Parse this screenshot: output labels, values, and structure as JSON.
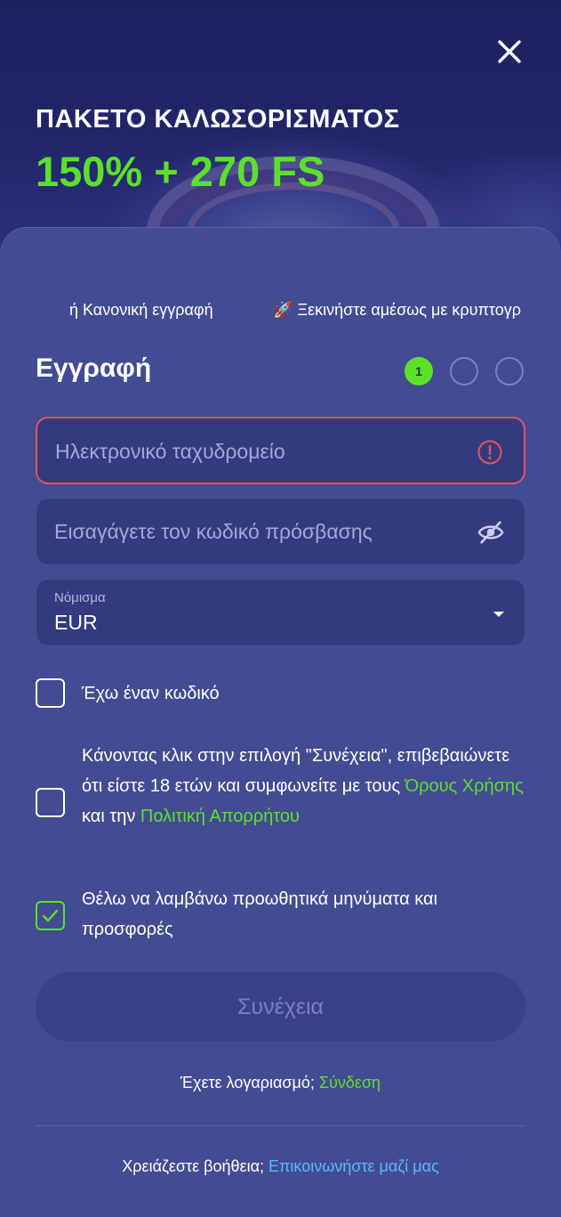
{
  "hero": {
    "title": "ΠΑΚΕΤΟ ΚΑΛΩΣΟΡΙΣΜΑΤΟΣ",
    "offer": "150% + 270 FS"
  },
  "tabs": [
    {
      "label": "ή Κανονική εγγραφή"
    },
    {
      "label": "🚀 Ξεκινήστε αμέσως με κρυπτογρ"
    }
  ],
  "form": {
    "title": "Εγγραφή",
    "steps": [
      "1",
      "",
      ""
    ],
    "email_placeholder": "Ηλεκτρονικό ταχυδρομείο",
    "password_placeholder": "Εισαγάγετε τον κωδικό πρόσβασης",
    "currency_label": "Νόμισμα",
    "currency_value": "EUR",
    "code_label": "Έχω έναν κωδικό",
    "terms_text_1": "Κάνοντας κλικ στην επιλογή \"Συνέχεια\", επιβεβαιώνετε ότι είστε 18 ετών και συμφωνείτε με τους ",
    "terms_link": "Όρους Χρήσης",
    "terms_text_2": " και την ",
    "privacy_link": "Πολιτική Απορρήτου",
    "promo_label": "Θέλω να λαμβάνω προωθητικά μηνύματα και προσφορές",
    "promo_checked": true,
    "continue_label": "Συνέχεια"
  },
  "footer": {
    "have_account": "Έχετε λογαριασμό; ",
    "login_link": "Σύνδεση",
    "need_help": "Χρειάζεστε βοήθεια; ",
    "contact_link": "Επικοινωνήστε μαζί μας"
  },
  "colors": {
    "accent_green": "#5ce12b",
    "error_red": "#e4545e",
    "link_blue": "#59b9ff",
    "card_bg": "#434b92"
  },
  "icons": {
    "close": "close-icon",
    "error": "alert-circle-icon",
    "password_toggle": "eye-off-icon",
    "dropdown": "caret-down-icon",
    "checkmark": "check-icon"
  }
}
